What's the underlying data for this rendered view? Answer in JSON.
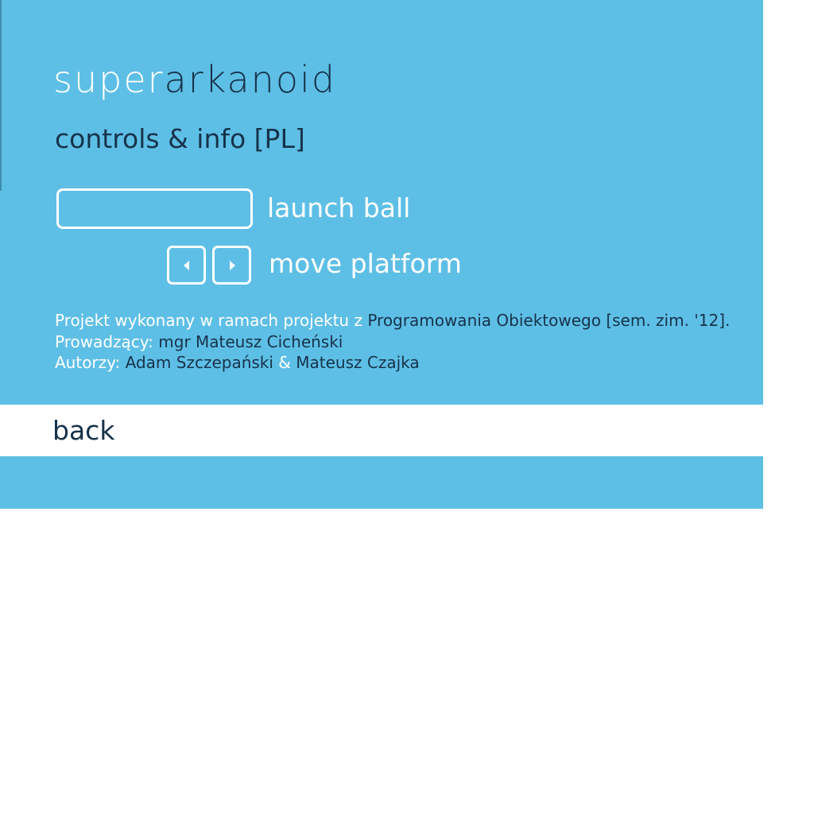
{
  "title": {
    "part1": "super",
    "part2": "arkanoid"
  },
  "subtitle": "controls & info [PL]",
  "controls": {
    "launch_label": "launch ball",
    "move_label": "move platform",
    "left_key_icon": "arrow-left-icon",
    "right_key_icon": "arrow-right-icon"
  },
  "info": {
    "line1_prefix": "Projekt wykonany w ramach projektu z ",
    "line1_course": "Programowania Obiektowego [sem. zim. '12]",
    "line1_suffix": ".",
    "line2_prefix": "Prowadzący: ",
    "line2_name": "mgr Mateusz Cicheński",
    "line3_prefix": "Autorzy: ",
    "line3_author1": "Adam Szczepański",
    "line3_amp": " & ",
    "line3_author2": "Mateusz Czajka"
  },
  "back_label": "back",
  "colors": {
    "panel": "#5ebfe6",
    "dark_text": "#17324a",
    "light_text": "#ffffff"
  }
}
